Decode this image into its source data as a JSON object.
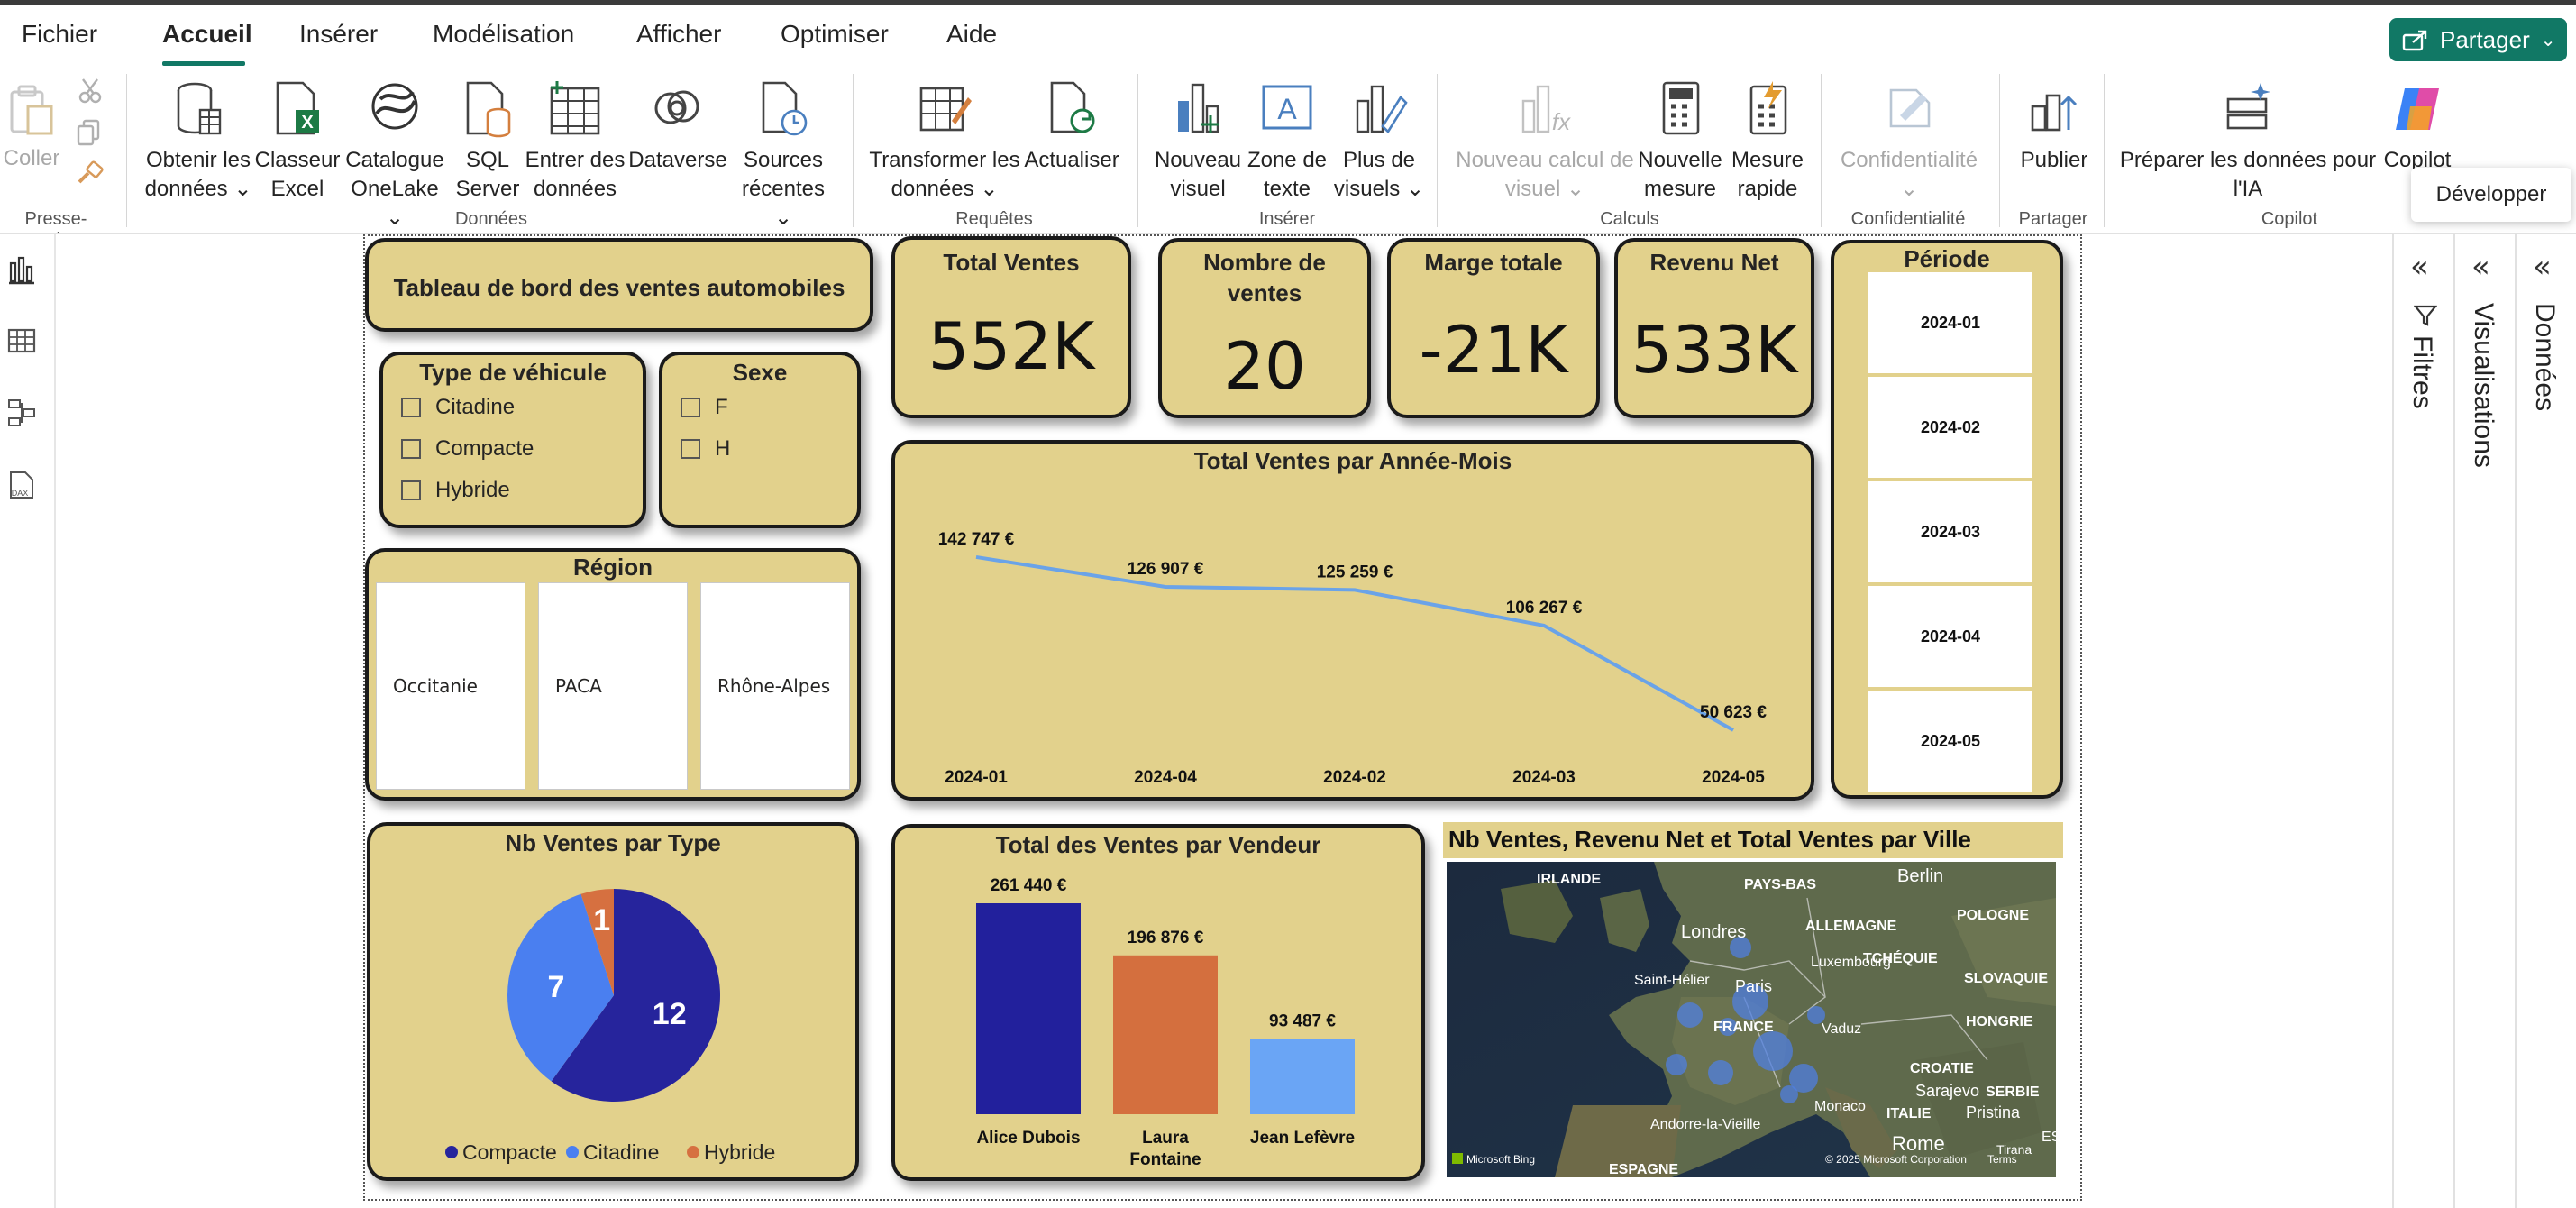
{
  "menu": {
    "items": [
      "Fichier",
      "Accueil",
      "Insérer",
      "Modélisation",
      "Afficher",
      "Optimiser",
      "Aide"
    ],
    "active": "Accueil",
    "share_label": "Partager"
  },
  "ribbon": {
    "paste": "Coller",
    "clipboard_group": "Presse-papiers",
    "get_data": [
      "Obtenir les",
      "données"
    ],
    "excel": [
      "Classeur",
      "Excel"
    ],
    "onelake": [
      "Catalogue",
      "OneLake"
    ],
    "sql": [
      "SQL",
      "Server"
    ],
    "enter_data": [
      "Entrer des",
      "données"
    ],
    "dataverse": "Dataverse",
    "recent": [
      "Sources",
      "récentes"
    ],
    "data_group": "Données",
    "transform": [
      "Transformer les",
      "données"
    ],
    "refresh": "Actualiser",
    "queries_group": "Requêtes",
    "new_visual": [
      "Nouveau",
      "visuel"
    ],
    "textbox": [
      "Zone de",
      "texte"
    ],
    "more_visuals": [
      "Plus de",
      "visuels"
    ],
    "insert_group": "Insérer",
    "new_calc": [
      "Nouveau calcul de",
      "visuel"
    ],
    "new_measure": [
      "Nouvelle",
      "mesure"
    ],
    "quick_measure": [
      "Mesure",
      "rapide"
    ],
    "calc_group": "Calculs",
    "sensitivity": "Confidentialité",
    "sensitivity_group": "Confidentialité",
    "publish": "Publier",
    "share_group": "Partager",
    "prepare_ai": [
      "Préparer les données pour",
      "l'IA"
    ],
    "copilot": "Copilot",
    "copilot_group": "Copilot",
    "tooltip": "Développer"
  },
  "panes": {
    "filters": "Filtres",
    "visualizations": "Visualisations",
    "data": "Données"
  },
  "report": {
    "title": "Tableau de bord des ventes automobiles",
    "kpis": {
      "total_sales": {
        "label": "Total Ventes",
        "value": "552K"
      },
      "nb_sales": {
        "label": "Nombre de ventes",
        "value": "20"
      },
      "margin": {
        "label": "Marge totale",
        "value": "-21K"
      },
      "net_revenue": {
        "label": "Revenu Net",
        "value": "533K"
      }
    },
    "vehicle_slicer": {
      "title": "Type de véhicule",
      "options": [
        "Citadine",
        "Compacte",
        "Hybride"
      ]
    },
    "sex_slicer": {
      "title": "Sexe",
      "options": [
        "F",
        "H"
      ]
    },
    "region_slicer": {
      "title": "Région",
      "options": [
        "Occitanie",
        "PACA",
        "Rhône-Alpes"
      ]
    },
    "period_slicer": {
      "title": "Période",
      "options": [
        "2024-01",
        "2024-02",
        "2024-03",
        "2024-04",
        "2024-05"
      ]
    },
    "map": {
      "title": "Nb Ventes, Revenu Net et Total Ventes par Ville",
      "labels": [
        "IRLANDE",
        "PAYS-BAS",
        "Berlin",
        "POLOGNE",
        "Londres",
        "ALLEMAGNE",
        "Luxembourg",
        "TCHÉQUIE",
        "Saint-Hélier",
        "Paris",
        "SLOVAQUIE",
        "FRANCE",
        "Vaduz",
        "HONGRIE",
        "CROATIE",
        "Sarajevo",
        "SERBIE",
        "Monaco",
        "Andorre-la-Vieille",
        "ITALIE",
        "Pristina",
        "Rome",
        "Tirana",
        "ESPAGNE",
        "Sk"
      ],
      "attribution": "© 2025 Microsoft Corporation",
      "terms": "Terms",
      "bing": "Microsoft Bing"
    }
  },
  "chart_data": [
    {
      "type": "line",
      "title": "Total Ventes par Année-Mois",
      "categories": [
        "2024-01",
        "2024-04",
        "2024-02",
        "2024-03",
        "2024-05"
      ],
      "values": [
        142747,
        126907,
        125259,
        106267,
        50623
      ],
      "data_labels": [
        "142 747 €",
        "126 907 €",
        "125 259 €",
        "106 267 €",
        "50 623 €"
      ],
      "color": "#6aa3e8",
      "grid": false
    },
    {
      "type": "pie",
      "title": "Nb Ventes par Type",
      "slices": [
        {
          "name": "Compacte",
          "value": 12,
          "color": "#26249c"
        },
        {
          "name": "Citadine",
          "value": 7,
          "color": "#4a7ff0"
        },
        {
          "name": "Hybride",
          "value": 1,
          "color": "#d67040"
        }
      ],
      "legend": "bottom"
    },
    {
      "type": "bar",
      "title": "Total des Ventes par Vendeur",
      "categories": [
        "Alice Dubois",
        "Laura Fontaine",
        "Jean Lefèvre"
      ],
      "values": [
        261440,
        196876,
        93487
      ],
      "data_labels": [
        "261 440 €",
        "196 876 €",
        "93 487 €"
      ],
      "colors": [
        "#22209c",
        "#d46f3e",
        "#6aa5f5"
      ],
      "grid": false
    }
  ]
}
